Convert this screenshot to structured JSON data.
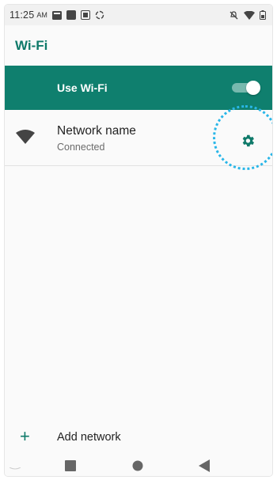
{
  "status_bar": {
    "time": "11:25",
    "ampm": "AM",
    "left_icons": [
      "notification-square-icon",
      "image-icon",
      "sim-icon",
      "sync-icon"
    ],
    "right_icons": [
      "mute-icon",
      "wifi-signal-icon",
      "battery-icon"
    ]
  },
  "app_bar": {
    "title": "Wi-Fi"
  },
  "use_wifi": {
    "label": "Use Wi-Fi",
    "enabled": true
  },
  "network": {
    "name": "Network name",
    "status": "Connected",
    "icon": "wifi-icon",
    "settings_icon": "gear-icon"
  },
  "add_network": {
    "label": "Add network",
    "icon": "plus-icon"
  },
  "nav_bar": {
    "buttons": [
      "recents-button",
      "home-button",
      "back-button"
    ]
  },
  "colors": {
    "accent": "#0f7a6a",
    "accent_bar": "#0f7f6e",
    "highlight": "#29b6e8",
    "toggle_track": "#77b9ae"
  }
}
